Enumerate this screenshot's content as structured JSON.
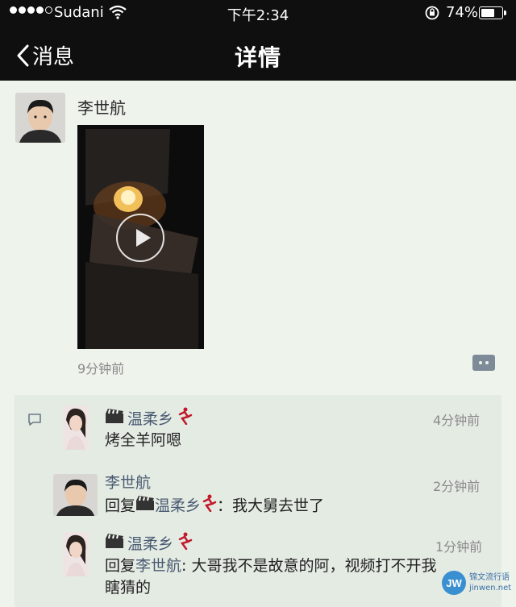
{
  "status_bar": {
    "carrier": "Sudani",
    "time": "下午2:34",
    "battery": "74%",
    "battery_level": 0.74
  },
  "nav": {
    "back_label": "消息",
    "title": "详情"
  },
  "post": {
    "author": "李世航",
    "time": "9分钟前"
  },
  "comments": [
    {
      "name": "温柔乡",
      "time": "4分钟前",
      "text": "烤全羊阿嗯"
    },
    {
      "name": "李世航",
      "time": "2分钟前",
      "reply_prefix": "回复",
      "reply_to": "温柔乡",
      "text": "：我大舅去世了"
    },
    {
      "name": "温柔乡",
      "time": "1分钟前",
      "reply_prefix": "回复",
      "reply_to": "李世航",
      "text_line1": ": 大哥我不是故意的阿，视频打不开我",
      "text_line2": "瞎猜的"
    }
  ],
  "watermark": {
    "logo": "JW",
    "line1": "锦文流行语",
    "line2": "jinwen.net"
  }
}
